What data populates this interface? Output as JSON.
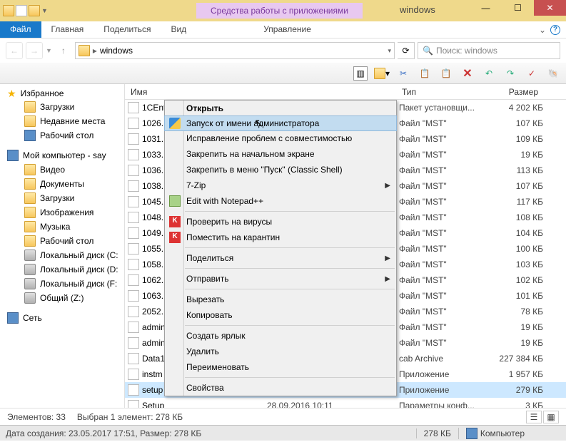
{
  "window": {
    "contexttab": "Средства работы с приложениями",
    "title": "windows"
  },
  "ribbon": {
    "file": "Файл",
    "home": "Главная",
    "share": "Поделиться",
    "view": "Вид",
    "manage": "Управление"
  },
  "address": {
    "path": "windows",
    "search_placeholder": "Поиск: windows"
  },
  "sidebar": {
    "favorites": {
      "header": "Избранное",
      "items": [
        "Загрузки",
        "Недавние места",
        "Рабочий стол"
      ]
    },
    "computer": {
      "header": "Мой компьютер - say",
      "items": [
        "Видео",
        "Документы",
        "Загрузки",
        "Изображения",
        "Музыка",
        "Рабочий стол",
        "Локальный диск (C:",
        "Локальный диск (D:",
        "Локальный диск (F:",
        "Общий (Z:)"
      ]
    },
    "network": {
      "header": "Сеть"
    }
  },
  "columns": {
    "name": "Имя",
    "date": "",
    "type": "Тип",
    "size": "Размер"
  },
  "files": [
    {
      "name": "1CEnt",
      "type": "Пакет установщи...",
      "size": "4 202 КБ"
    },
    {
      "name": "1026.",
      "type": "Файл \"MST\"",
      "size": "107 КБ"
    },
    {
      "name": "1031.",
      "type": "Файл \"MST\"",
      "size": "109 КБ"
    },
    {
      "name": "1033.",
      "type": "Файл \"MST\"",
      "size": "19 КБ"
    },
    {
      "name": "1036.",
      "type": "Файл \"MST\"",
      "size": "113 КБ"
    },
    {
      "name": "1038.",
      "type": "Файл \"MST\"",
      "size": "107 КБ"
    },
    {
      "name": "1045.",
      "type": "Файл \"MST\"",
      "size": "117 КБ"
    },
    {
      "name": "1048.",
      "type": "Файл \"MST\"",
      "size": "108 КБ"
    },
    {
      "name": "1049.",
      "type": "Файл \"MST\"",
      "size": "104 КБ"
    },
    {
      "name": "1055.",
      "type": "Файл \"MST\"",
      "size": "100 КБ"
    },
    {
      "name": "1058.",
      "type": "Файл \"MST\"",
      "size": "103 КБ"
    },
    {
      "name": "1062.",
      "type": "Файл \"MST\"",
      "size": "102 КБ"
    },
    {
      "name": "1063.",
      "type": "Файл \"MST\"",
      "size": "101 КБ"
    },
    {
      "name": "2052.",
      "type": "Файл \"MST\"",
      "size": "78 КБ"
    },
    {
      "name": "admin",
      "type": "Файл \"MST\"",
      "size": "19 КБ"
    },
    {
      "name": "admin",
      "type": "Файл \"MST\"",
      "size": "19 КБ"
    },
    {
      "name": "Data1",
      "type": "cab Archive",
      "size": "227 384 КБ"
    },
    {
      "name": "instm",
      "type": "Приложение",
      "size": "1 957 КБ"
    },
    {
      "name": "setup",
      "type": "Приложение",
      "size": "279 КБ",
      "selected": true
    },
    {
      "name": "Setup",
      "date": "28.09.2016 10:11",
      "type": "Параметры конф...",
      "size": "3 КБ"
    }
  ],
  "context": {
    "open": "Открыть",
    "runas": "Запуск от имени администратора",
    "compat": "Исправление проблем с совместимостью",
    "pinstart": "Закрепить на начальном экране",
    "pinmenu": "Закрепить в меню \"Пуск\" (Classic Shell)",
    "sevenzip": "7-Zip",
    "notepad": "Edit with Notepad++",
    "scan": "Проверить на вирусы",
    "quarantine": "Поместить на карантин",
    "share": "Поделиться",
    "sendto": "Отправить",
    "cut": "Вырезать",
    "copy": "Копировать",
    "shortcut": "Создать ярлык",
    "delete": "Удалить",
    "rename": "Переименовать",
    "properties": "Свойства"
  },
  "status1": {
    "count": "Элементов: 33",
    "sel": "Выбран 1 элемент: 278 КБ"
  },
  "status2": {
    "meta": "Дата создания: 23.05.2017 17:51, Размер: 278 КБ",
    "size": "278 КБ",
    "location": "Компьютер"
  }
}
